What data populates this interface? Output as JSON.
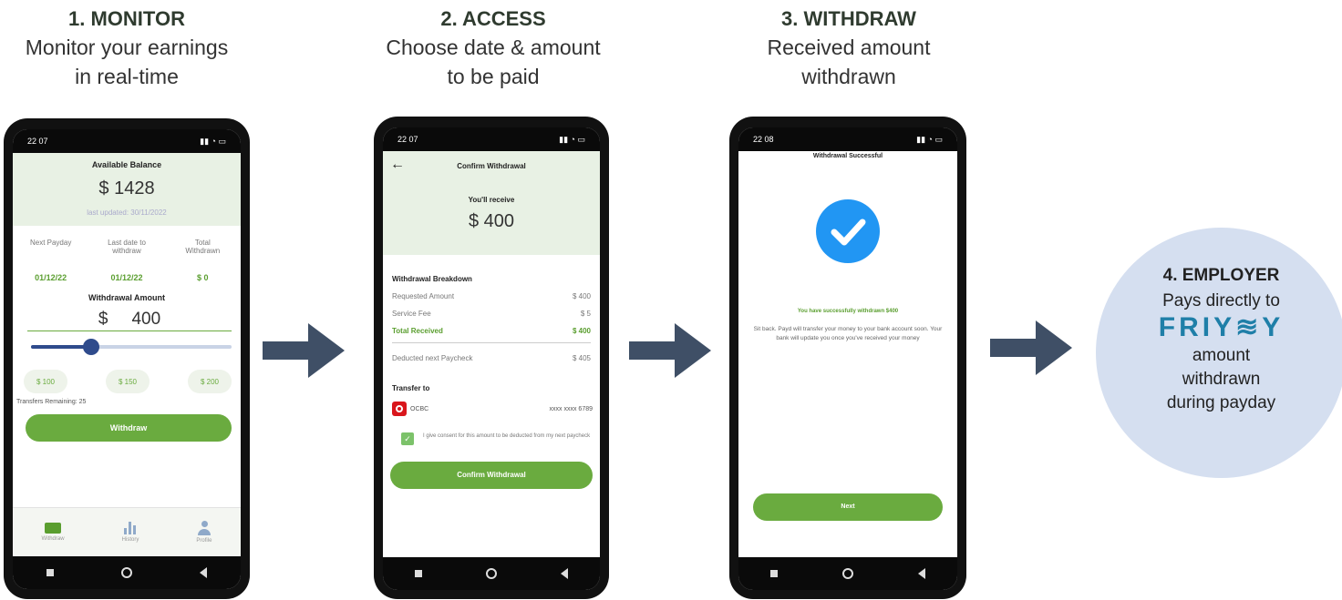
{
  "steps": [
    {
      "num": "1. MONITOR",
      "desc": "Monitor your earnings\nin real-time"
    },
    {
      "num": "2. ACCESS",
      "desc": "Choose date & amount\nto be paid"
    },
    {
      "num": "3. WITHDRAW",
      "desc": "Received amount\nwithdrawn"
    }
  ],
  "employer": {
    "num": "4. EMPLOYER",
    "line1": "Pays directly to",
    "brand": "FRIY≋Y",
    "line2": "amount",
    "line3": "withdrawn",
    "line4": "during payday"
  },
  "phone1": {
    "time": "22 07",
    "title": "Available Balance",
    "balance": "$ 1428",
    "updated": "last updated: 30/11/2022",
    "col1_label": "Next Payday",
    "col2_label": "Last date to\nwithdraw",
    "col3_label": "Total\nWithdrawn",
    "col1_value": "01/12/22",
    "col2_value": "01/12/22",
    "col3_value": "$ 0",
    "amount_label": "Withdrawal Amount",
    "currency": "$",
    "amount": "400",
    "slider_percent": 30,
    "presets": [
      "$ 100",
      "$ 150",
      "$ 200"
    ],
    "transfers": "Transfers Remaining: 25",
    "withdraw_btn": "Withdraw",
    "tabs": [
      "Withdraw",
      "History",
      "Profile"
    ]
  },
  "phone2": {
    "time": "22 07",
    "title": "Confirm Withdrawal",
    "receive_label": "You'll receive",
    "receive_amount": "$ 400",
    "breakdown_title": "Withdrawal Breakdown",
    "rows": [
      {
        "label": "Requested Amount",
        "value": "$ 400"
      },
      {
        "label": "Service Fee",
        "value": "$ 5"
      },
      {
        "label": "Total Received",
        "value": "$ 400"
      }
    ],
    "deducted_label": "Deducted next Paycheck",
    "deducted_value": "$ 405",
    "transfer_title": "Transfer to",
    "bank": "OCBC",
    "account": "xxxx xxxx 6789",
    "consent": "I give consent for this amount to be deducted from my next paycheck",
    "confirm_btn": "Confirm Withdrawal"
  },
  "phone3": {
    "time": "22 08",
    "title": "Withdrawal Successful",
    "success": "You have successfully withdrawn $400",
    "message": "Sit back. Payd will transfer your money to your bank account soon. Your bank will update you once you've received your money",
    "next_btn": "Next"
  },
  "colors": {
    "accent": "#6aab3f",
    "arrow": "#3f4f66",
    "circle": "#d5dff0",
    "check": "#2196f3"
  }
}
